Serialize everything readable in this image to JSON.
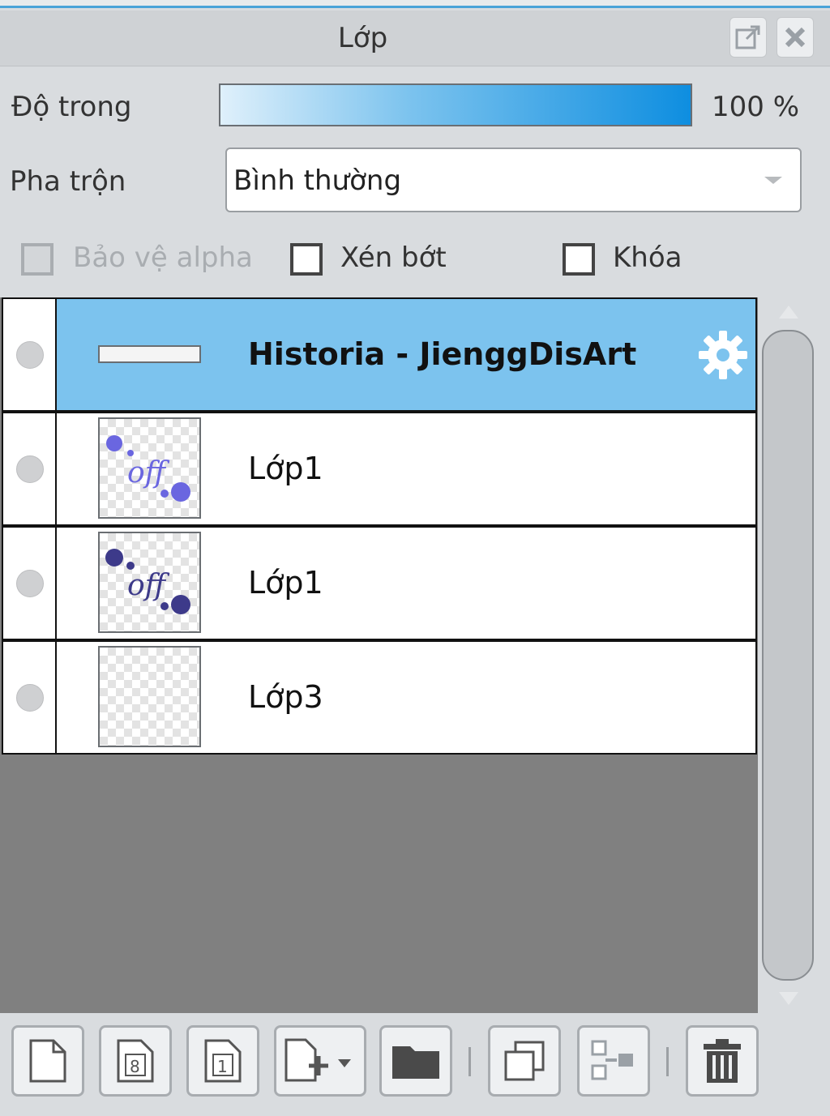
{
  "panel": {
    "title": "Lớp",
    "opacity_label": "Độ trong",
    "opacity_value": "100 %",
    "opacity_fraction": 1.0,
    "blend_label": "Pha trộn",
    "blend_value": "Bình thường",
    "checkboxes": [
      {
        "label": "Bảo vệ alpha",
        "checked": false,
        "disabled": true
      },
      {
        "label": "Xén bớt",
        "checked": false,
        "disabled": false
      },
      {
        "label": "Khóa",
        "checked": false,
        "disabled": false
      }
    ]
  },
  "layers": [
    {
      "name": "Historia - JienggDisArt",
      "selected": true,
      "type": "text"
    },
    {
      "name": "Lớp1",
      "selected": false,
      "type": "raster"
    },
    {
      "name": "Lớp1",
      "selected": false,
      "type": "raster"
    },
    {
      "name": "Lớp3",
      "selected": false,
      "type": "raster"
    }
  ],
  "colors": {
    "selection": "#7cc3ee",
    "accent": "#0e8ee0",
    "empty_area": "#808080"
  },
  "toolbar": {
    "buttons": [
      "new-layer-icon",
      "new-8bit-layer-icon",
      "new-1bit-layer-icon",
      "add-layer-dropdown-icon",
      "folder-icon",
      "duplicate-icon",
      "merge-down-icon",
      "trash-icon"
    ]
  }
}
